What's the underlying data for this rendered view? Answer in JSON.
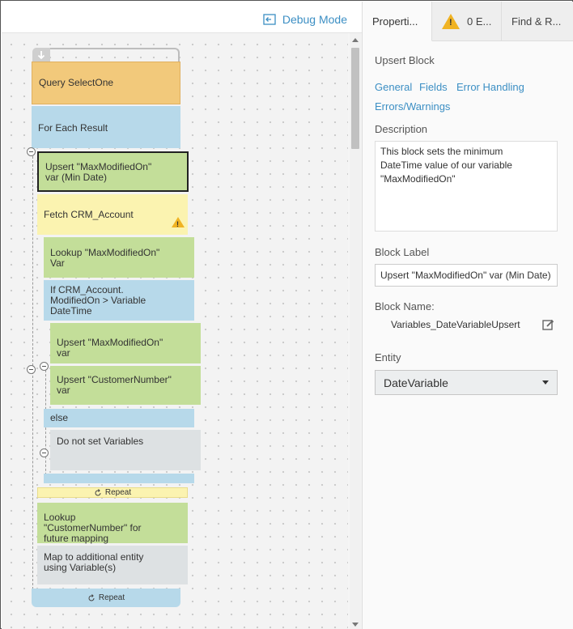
{
  "canvas": {
    "debug_mode": "Debug Mode",
    "blocks": {
      "query": "Query SelectOne",
      "foreach": "For Each Result",
      "upsert_min": "Upsert \"MaxModifiedOn\"\nvar (Min Date)",
      "fetch": "Fetch CRM_Account",
      "lookup_mm": "Lookup \"MaxModifiedOn\"\nVar",
      "if_cond": "If CRM_Account.\nModifiedOn > Variable\nDateTime",
      "upsert_mm": "Upsert \"MaxModifiedOn\"\nvar",
      "upsert_cn": "Upsert \"CustomerNumber\"\nvar",
      "else": "else",
      "do_not_set": "Do not set Variables",
      "repeat_inner": "Repeat",
      "lookup_cn": "Lookup\n\"CustomerNumber\" for\nfuture mapping",
      "map": "Map to additional entity\nusing Variable(s)",
      "repeat_outer": "Repeat"
    }
  },
  "panel": {
    "tabs": {
      "properties": "Properti...",
      "errors": "0 E...",
      "find": "Find & R..."
    },
    "block_type": "Upsert Block",
    "links": {
      "general": "General",
      "fields": "Fields",
      "error_handling": "Error Handling",
      "errors_warnings": "Errors/Warnings"
    },
    "description_label": "Description",
    "description_value": "This block sets the minimum\nDateTime value of our variable\n\"MaxModifiedOn\"",
    "block_label_label": "Block Label",
    "block_label_value": "Upsert \"MaxModifiedOn\" var (Min Date)",
    "block_name_label": "Block Name:",
    "block_name_value": "Variables_DateVariableUpsert",
    "entity_label": "Entity",
    "entity_value": "DateVariable"
  },
  "colors": {
    "accent": "#3c8fc4",
    "query_block": "#f2c97b",
    "loop_block": "#b7d9ea",
    "action_block": "#c3de99",
    "fetch_block": "#fbf3b0",
    "disabled_block": "#dde1e3",
    "warning": "#f0b323"
  }
}
